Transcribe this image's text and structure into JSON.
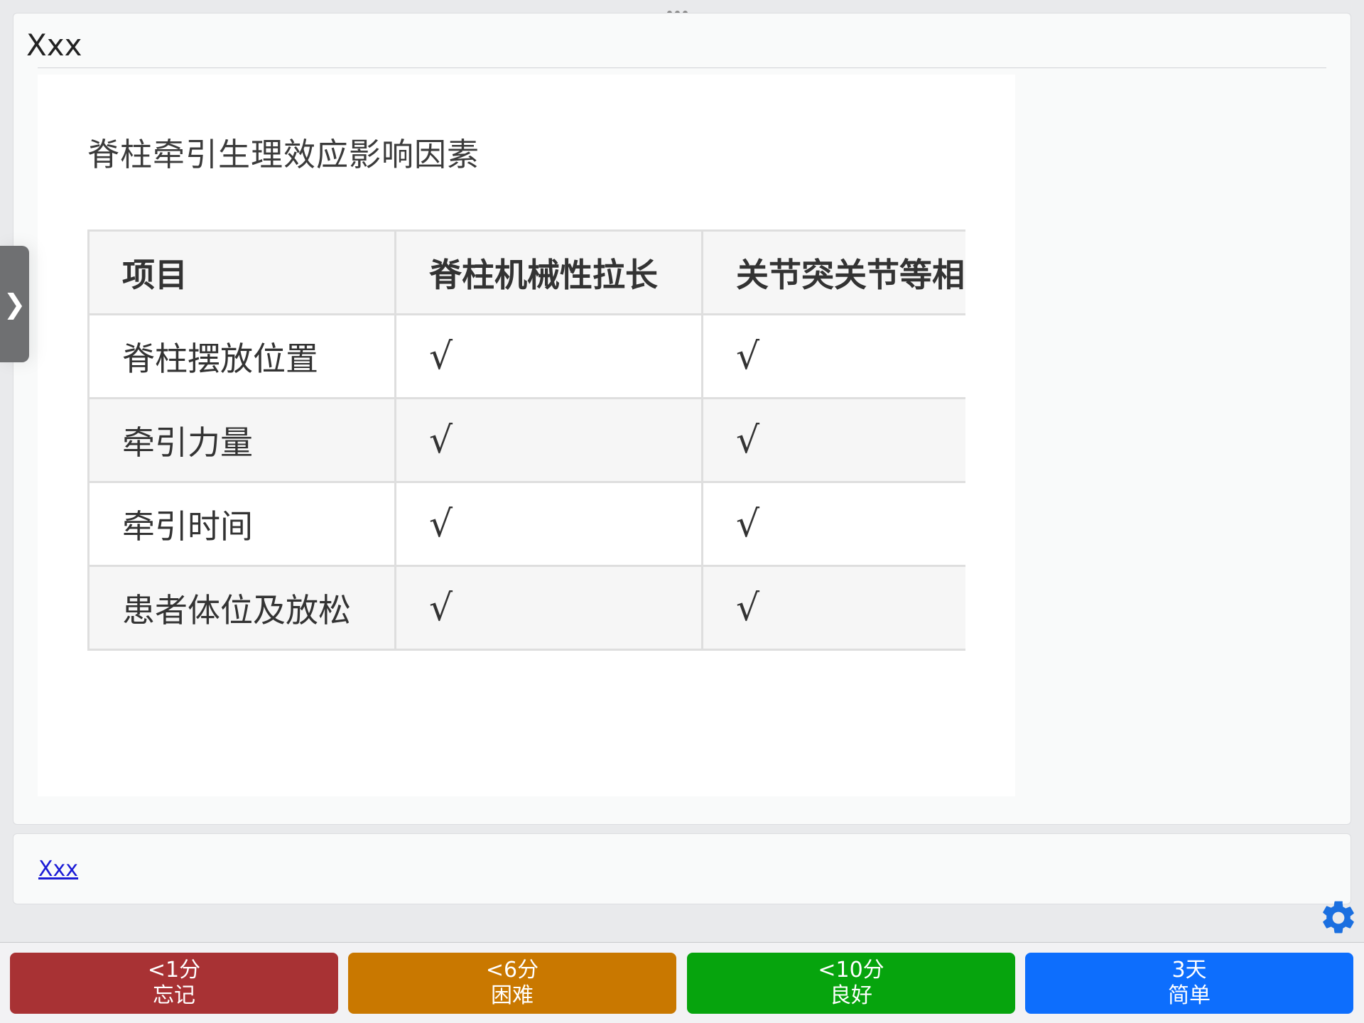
{
  "card": {
    "title": "Xxx",
    "note": {
      "heading": "脊柱牵引生理效应影响因素",
      "table": {
        "headers": [
          "项目",
          "脊柱机械性拉长",
          "关节突关节等相"
        ],
        "rows": [
          [
            "脊柱摆放位置",
            "√",
            "√"
          ],
          [
            "牵引力量",
            "√",
            "√"
          ],
          [
            "牵引时间",
            "√",
            "√"
          ],
          [
            "患者体位及放松",
            "√",
            "√"
          ]
        ]
      }
    }
  },
  "back": {
    "link": "Xxx"
  },
  "sidebar_toggle": "❯",
  "answers": [
    {
      "interval": "<1分",
      "label": "忘记",
      "color": "#a83234"
    },
    {
      "interval": "<6分",
      "label": "困难",
      "color": "#c97800"
    },
    {
      "interval": "<10分",
      "label": "良好",
      "color": "#06a40d"
    },
    {
      "interval": "3天",
      "label": "简单",
      "color": "#0d6efd"
    }
  ],
  "icons": {
    "more": "more-dots-icon",
    "sidebar": "chevron-right-icon",
    "settings": "gear-icon"
  },
  "accent_colors": {
    "link": "#1b1bd6",
    "gear": "#1a6fe0"
  }
}
